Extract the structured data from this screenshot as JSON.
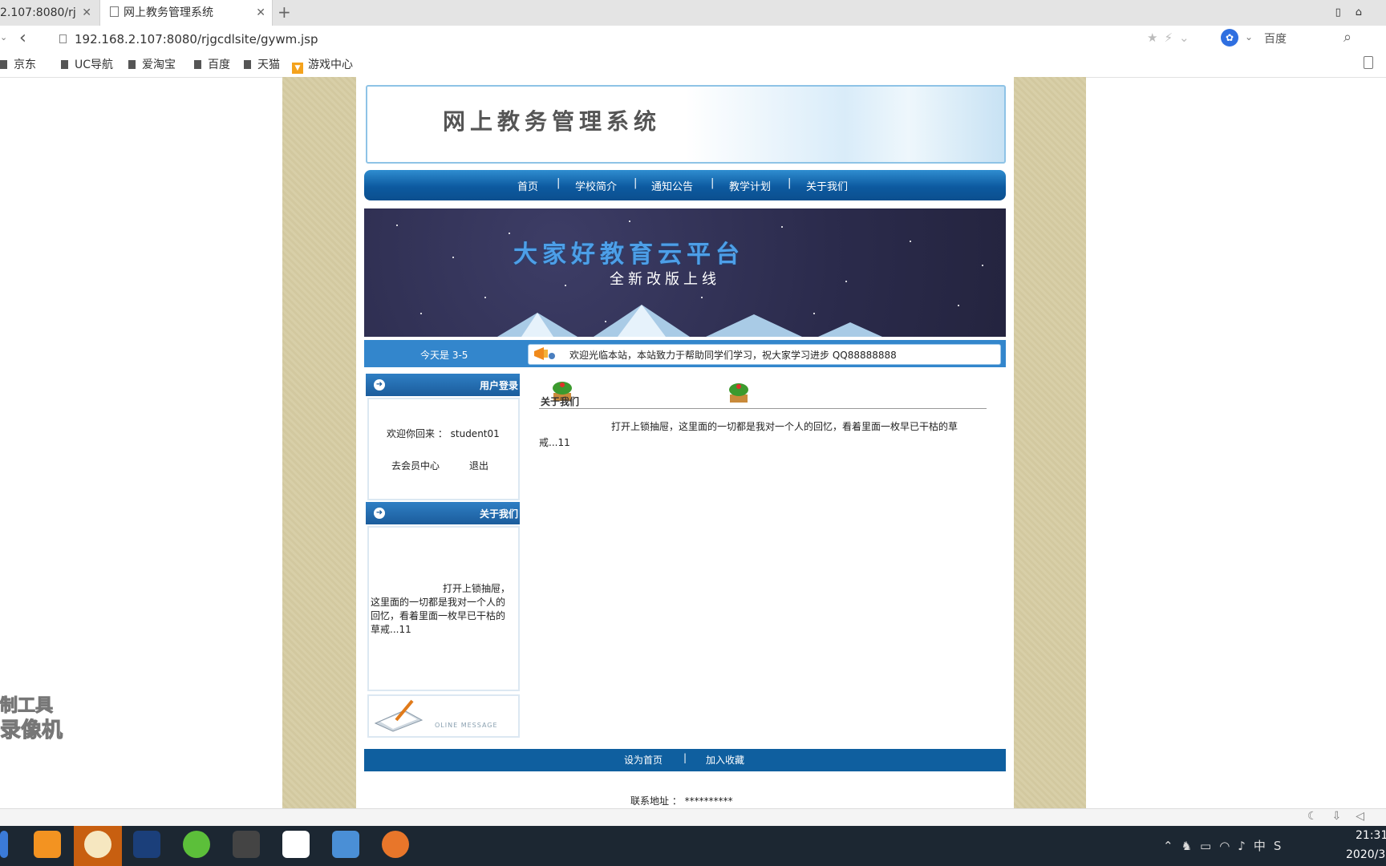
{
  "browser": {
    "tabs": [
      {
        "label": "2.107:8080/rj",
        "active": false
      },
      {
        "label": "网上教务管理系统",
        "active": true
      }
    ],
    "url": "192.168.2.107:8080/rjgcdlsite/gywm.jsp",
    "search_engine": "百度",
    "bookmarks": [
      "京东",
      "UC导航",
      "爱淘宝",
      "百度",
      "天猫",
      "游戏中心"
    ]
  },
  "site": {
    "title": "网上教务管理系统",
    "nav": [
      "首页",
      "学校简介",
      "通知公告",
      "教学计划",
      "关于我们"
    ],
    "banner": {
      "title": "大家好教育云平台",
      "subtitle": "全新改版上线"
    },
    "today": "今天是 3-5",
    "marquee": "欢迎光临本站，本站致力于帮助同学们学习，祝大家学习进步 QQ88888888"
  },
  "sidebar": {
    "login_header": "用户登录",
    "welcome": "欢迎你回来 ： student01",
    "member_center": "去会员中心",
    "logout": "退出",
    "about_header": "关于我们",
    "about_text": "打开上锁抽屉，这里面的一切都是我对一个人的回忆，看着里面一枚早已干枯的草戒...11",
    "message_label": "OLINE MESSAGE"
  },
  "content": {
    "title": "关于我们",
    "text": "打开上锁抽屉，这里面的一切都是我对一个人的回忆，看着里面一枚早已干枯的草戒...11"
  },
  "footer": {
    "set_home": "设为首页",
    "add_favorite": "加入收藏",
    "contact": "联系地址 ： **********"
  },
  "watermark": {
    "line1": "制工具",
    "line2": "录像机"
  },
  "taskbar": {
    "time": "21:31",
    "date": "2020/3"
  },
  "colors": {
    "nav_blue": "#0d5aa0",
    "info_blue": "#3386cc",
    "footer_blue": "#0f5f9f",
    "page_border_texture": "#d8cfa8"
  }
}
